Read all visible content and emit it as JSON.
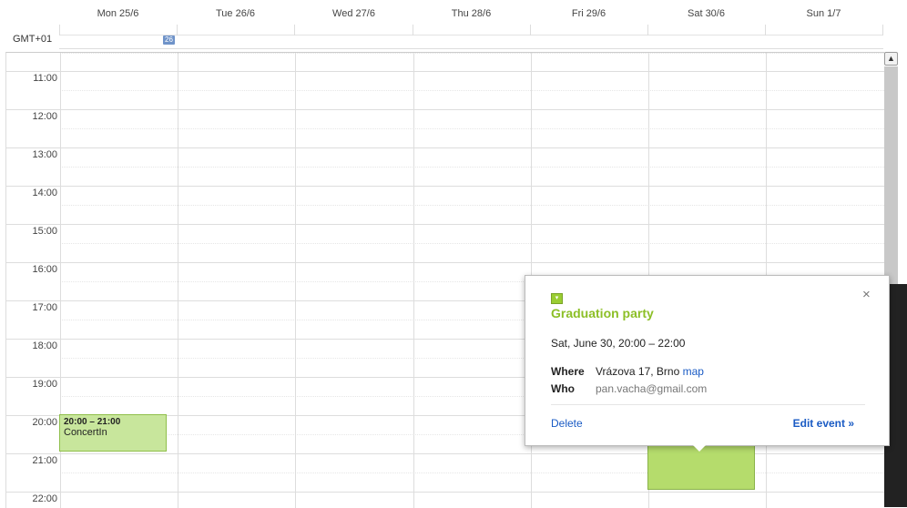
{
  "days": [
    "Mon 25/6",
    "Tue 26/6",
    "Wed 27/6",
    "Thu 28/6",
    "Fri 29/6",
    "Sat 30/6",
    "Sun 1/7"
  ],
  "timezone": "GMT+01",
  "week_badge": "26",
  "hours": [
    "11:00",
    "12:00",
    "13:00",
    "14:00",
    "15:00",
    "16:00",
    "17:00",
    "18:00",
    "19:00",
    "20:00",
    "21:00",
    "22:00"
  ],
  "events": {
    "concert": {
      "time": "20:00 – 21:00",
      "title": "ConcertIn",
      "color": "#c8e69c"
    },
    "graduation": {
      "color": "#b5dc6c"
    }
  },
  "popup": {
    "close": "×",
    "chip": "▾",
    "title": "Graduation party",
    "when": "Sat, June 30, 20:00 – 22:00",
    "where_label": "Where",
    "where_value": "Vrázova 17, Brno",
    "map_link": "map",
    "who_label": "Who",
    "who_value": "pan.vacha@gmail.com",
    "delete": "Delete",
    "edit": "Edit event »",
    "accent": "#8cbf26"
  },
  "scroll_up": "▲"
}
